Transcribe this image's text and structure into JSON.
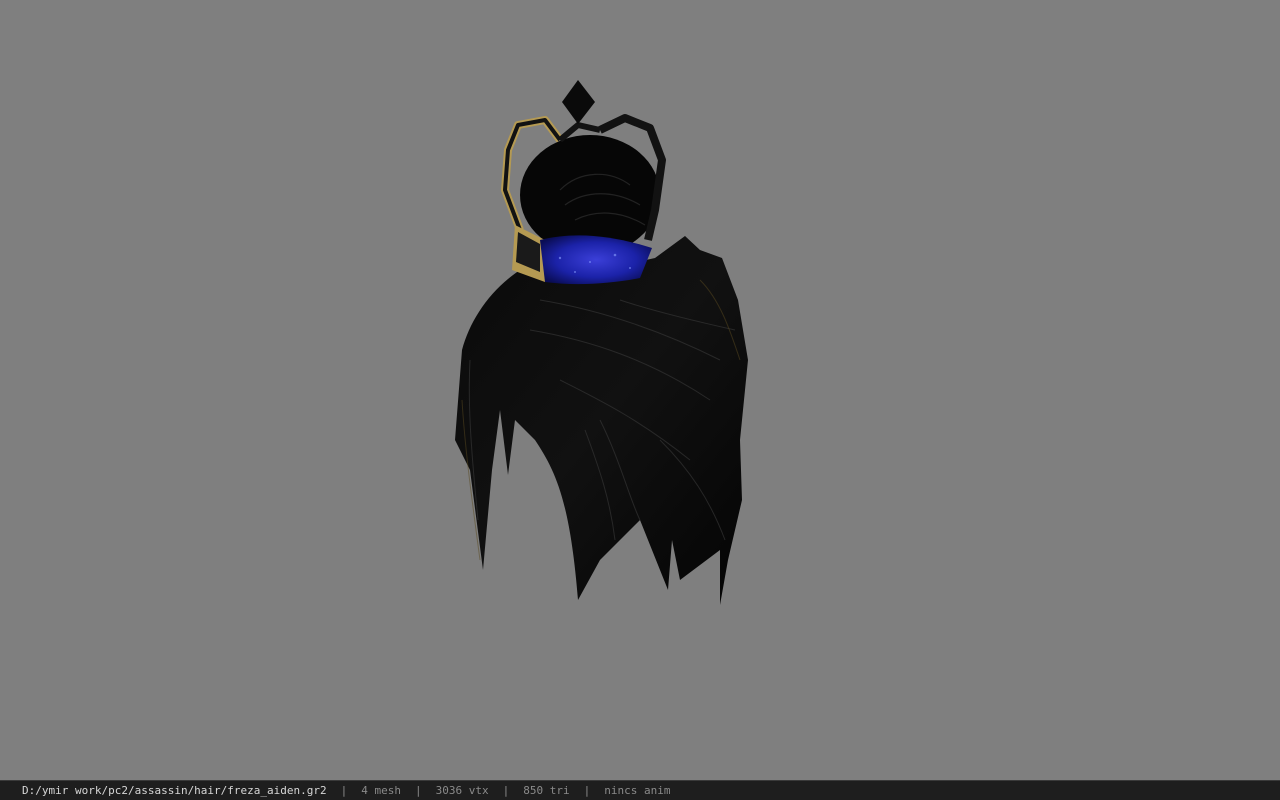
{
  "viewport": {
    "background_color": "#7f7f7f",
    "model_icon": "hair-crown-model"
  },
  "status": {
    "path": "D:/ymir work/pc2/assassin/hair/freza_aiden.gr2",
    "separator": "|",
    "mesh": "4 mesh",
    "vtx": "3036 vtx",
    "tri": "850 tri",
    "anim": "nincs anim"
  },
  "colors": {
    "hair": "#050505",
    "gold": "#b59a52",
    "blue_band": "#1b22a8"
  }
}
